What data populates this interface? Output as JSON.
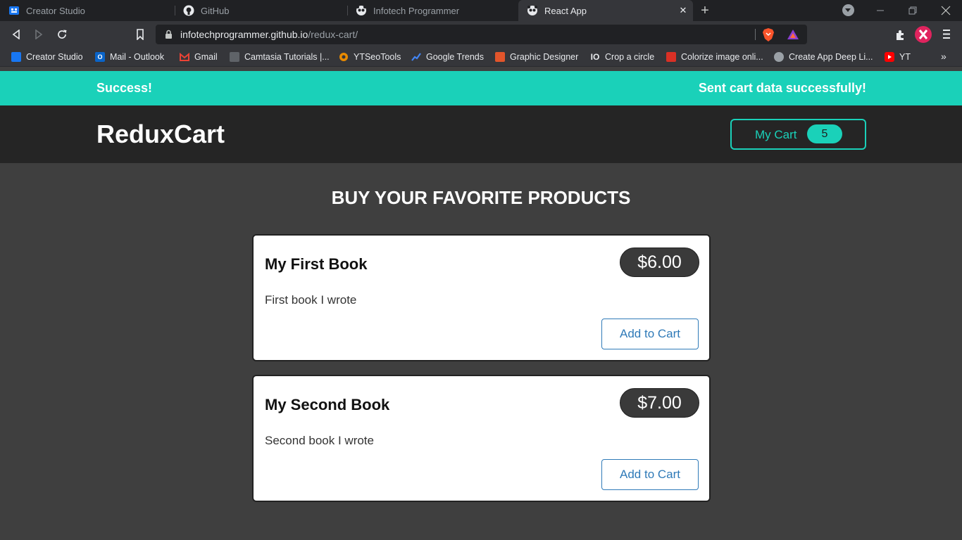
{
  "browser": {
    "tabs": [
      {
        "title": "Creator Studio",
        "icon": "creator-studio-icon"
      },
      {
        "title": "GitHub",
        "icon": "github-icon"
      },
      {
        "title": "Infotech Programmer",
        "icon": "panda-icon"
      },
      {
        "title": "React App",
        "icon": "panda-icon",
        "active": true
      }
    ],
    "url_host": "infotechprogrammer.github.io",
    "url_path": "/redux-cart/",
    "bookmarks": [
      {
        "label": "Creator Studio",
        "icon": "creator-studio-icon",
        "color": "#1877f2"
      },
      {
        "label": "Mail - Outlook",
        "icon": "outlook-icon",
        "color": "#0a64c8"
      },
      {
        "label": "Gmail",
        "icon": "gmail-icon",
        "color": "#ea4335"
      },
      {
        "label": "Camtasia Tutorials |...",
        "icon": "camtasia-icon",
        "color": "#6b6b6b"
      },
      {
        "label": "YTSeoTools",
        "icon": "ytseotools-icon",
        "color": "#e88a00"
      },
      {
        "label": "Google Trends",
        "icon": "google-trends-icon",
        "color": "#4285f4"
      },
      {
        "label": "Graphic Designer",
        "icon": "graphic-designer-icon",
        "color": "#e2552b"
      },
      {
        "label": "Crop a circle",
        "icon": "crop-circle-icon",
        "color": "#35363a"
      },
      {
        "label": "Colorize image onli...",
        "icon": "colorize-icon",
        "color": "#d93025"
      },
      {
        "label": "Create App Deep Li...",
        "icon": "deeplink-icon",
        "color": "#9aa0a6"
      },
      {
        "label": "YT",
        "icon": "youtube-icon",
        "color": "#ff0000"
      }
    ]
  },
  "notification": {
    "title": "Success!",
    "message": "Sent cart data successfully!",
    "color": "#1ad1b9"
  },
  "header": {
    "logo": "ReduxCart",
    "cart_label": "My Cart",
    "cart_count": "5"
  },
  "products_heading": "BUY YOUR FAVORITE PRODUCTS",
  "products": [
    {
      "title": "My First Book",
      "price": "$6.00",
      "description": "First book I wrote",
      "button": "Add to Cart"
    },
    {
      "title": "My Second Book",
      "price": "$7.00",
      "description": "Second book I wrote",
      "button": "Add to Cart"
    }
  ]
}
